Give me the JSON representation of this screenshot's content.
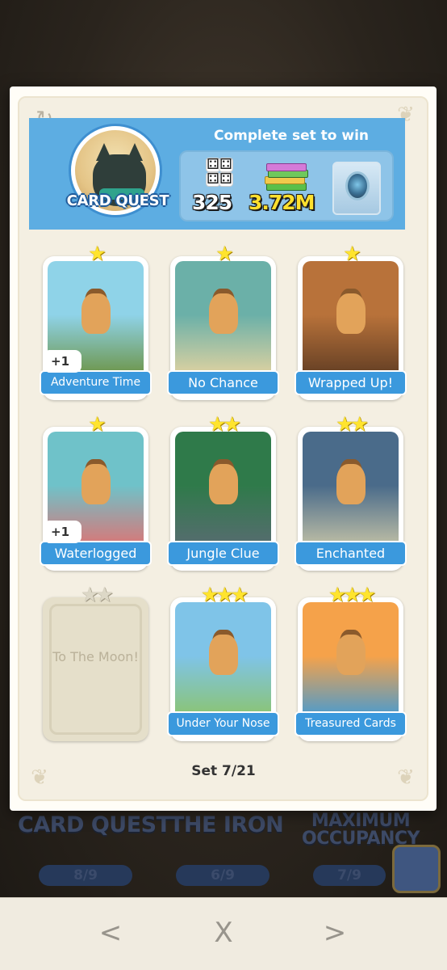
{
  "background": {
    "labels": [
      "CARD QUEST",
      "THE IRON",
      "MAXIMUM OCCUPANCY"
    ],
    "progress": [
      "8/9",
      "6/9",
      "7/9"
    ]
  },
  "header": {
    "title": "CARD QUEST",
    "complete_text": "Complete set to win",
    "rewards": {
      "dice": "325",
      "cash": "3.72M"
    }
  },
  "cards": [
    {
      "name": "Adventure Time",
      "stars": 1,
      "badge": "+1",
      "colors": [
        "#8fd3e8",
        "#6a8f3a"
      ]
    },
    {
      "name": "No Chance",
      "stars": 1,
      "badge": "",
      "colors": [
        "#6bb0a8",
        "#e9d5a0"
      ]
    },
    {
      "name": "Wrapped Up!",
      "stars": 1,
      "badge": "",
      "colors": [
        "#b8723a",
        "#5c3a22"
      ]
    },
    {
      "name": "Waterlogged",
      "stars": 1,
      "badge": "+1",
      "colors": [
        "#6fc2c9",
        "#e46f6f"
      ]
    },
    {
      "name": "Jungle Clue",
      "stars": 2,
      "badge": "",
      "colors": [
        "#2f7a4a",
        "#5a6b73"
      ]
    },
    {
      "name": "Enchanted",
      "stars": 2,
      "badge": "",
      "colors": [
        "#4a6b8a",
        "#c9c6a8"
      ]
    },
    {
      "name": "To The Moon!",
      "stars": 2,
      "badge": "",
      "locked": true,
      "colors": [
        "#e5dfca",
        "#e5dfca"
      ]
    },
    {
      "name": "Under Your Nose",
      "stars": 3,
      "badge": "",
      "colors": [
        "#7fc4e8",
        "#8cc468"
      ]
    },
    {
      "name": "Treasured Cards",
      "stars": 3,
      "badge": "",
      "colors": [
        "#f5a24a",
        "#3c9ad9"
      ]
    }
  ],
  "footer": {
    "set_text": "Set 7/21"
  },
  "nav": {
    "prev": "<",
    "close": "X",
    "next": ">"
  }
}
